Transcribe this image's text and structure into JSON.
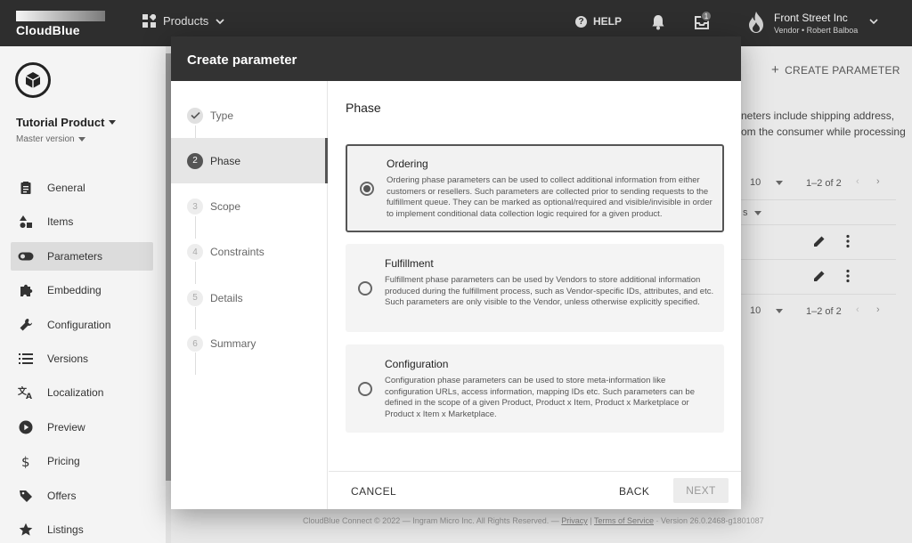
{
  "topbar": {
    "logo_text": "CloudBlue",
    "products_label": "Products",
    "help_label": "HELP",
    "inbox_count": "1",
    "account_name": "Front Street Inc",
    "account_sub": "Vendor • Robert Balboa"
  },
  "sidebar": {
    "product_name": "Tutorial Product",
    "version": "Master version",
    "items": [
      {
        "label": "General",
        "icon": "clipboard-icon"
      },
      {
        "label": "Items",
        "icon": "shapes-icon"
      },
      {
        "label": "Parameters",
        "icon": "toggle-icon"
      },
      {
        "label": "Embedding",
        "icon": "puzzle-icon"
      },
      {
        "label": "Configuration",
        "icon": "wrench-icon"
      },
      {
        "label": "Versions",
        "icon": "list-icon"
      },
      {
        "label": "Localization",
        "icon": "translate-icon"
      },
      {
        "label": "Preview",
        "icon": "play-icon"
      },
      {
        "label": "Pricing",
        "icon": "dollar-icon"
      },
      {
        "label": "Offers",
        "icon": "tag-icon"
      },
      {
        "label": "Listings",
        "icon": "star-icon"
      }
    ],
    "active_index": 2
  },
  "background": {
    "create_parameter": "CREATE PARAMETER",
    "line1": "neters include shipping address,",
    "line2": "om the consumer while processing",
    "rows_per_page": "10",
    "range": "1–2 of 2",
    "col_fragment": "s",
    "footer_prefix": "CloudBlue Connect © 2022 — Ingram Micro Inc. All Rights Reserved. — ",
    "footer_privacy": "Privacy",
    "footer_terms": "Terms of Service",
    "footer_version": " · Version 26.0.2468-g1801087"
  },
  "dialog": {
    "title": "Create parameter",
    "steps": [
      {
        "num": "",
        "label": "Type",
        "state": "done"
      },
      {
        "num": "2",
        "label": "Phase",
        "state": "active"
      },
      {
        "num": "3",
        "label": "Scope",
        "state": "pending"
      },
      {
        "num": "4",
        "label": "Constraints",
        "state": "pending"
      },
      {
        "num": "5",
        "label": "Details",
        "state": "pending"
      },
      {
        "num": "6",
        "label": "Summary",
        "state": "pending"
      }
    ],
    "section_title": "Phase",
    "options": [
      {
        "title": "Ordering",
        "desc": "Ordering phase parameters can be used to collect additional information from either customers or resellers. Such parameters are collected prior to sending requests to the fulfillment queue. They can be marked as optional/required and visible/invisible in order to implement conditional data collection logic required for a given product.",
        "selected": true
      },
      {
        "title": "Fulfillment",
        "desc": "Fulfillment phase parameters can be used by Vendors to store additional information produced during the fulfillment process, such as Vendor-specific IDs, attributes, and etc. Such parameters are only visible to the Vendor, unless otherwise explicitly specified.",
        "selected": false
      },
      {
        "title": "Configuration",
        "desc": "Configuration phase parameters can be used to store meta-information like configuration URLs, access information, mapping IDs etc. Such parameters can be defined in the scope of a given Product, Product x Item, Product x Marketplace or Product x Item x Marketplace.",
        "selected": false
      }
    ],
    "cancel": "CANCEL",
    "back": "BACK",
    "next": "NEXT"
  }
}
